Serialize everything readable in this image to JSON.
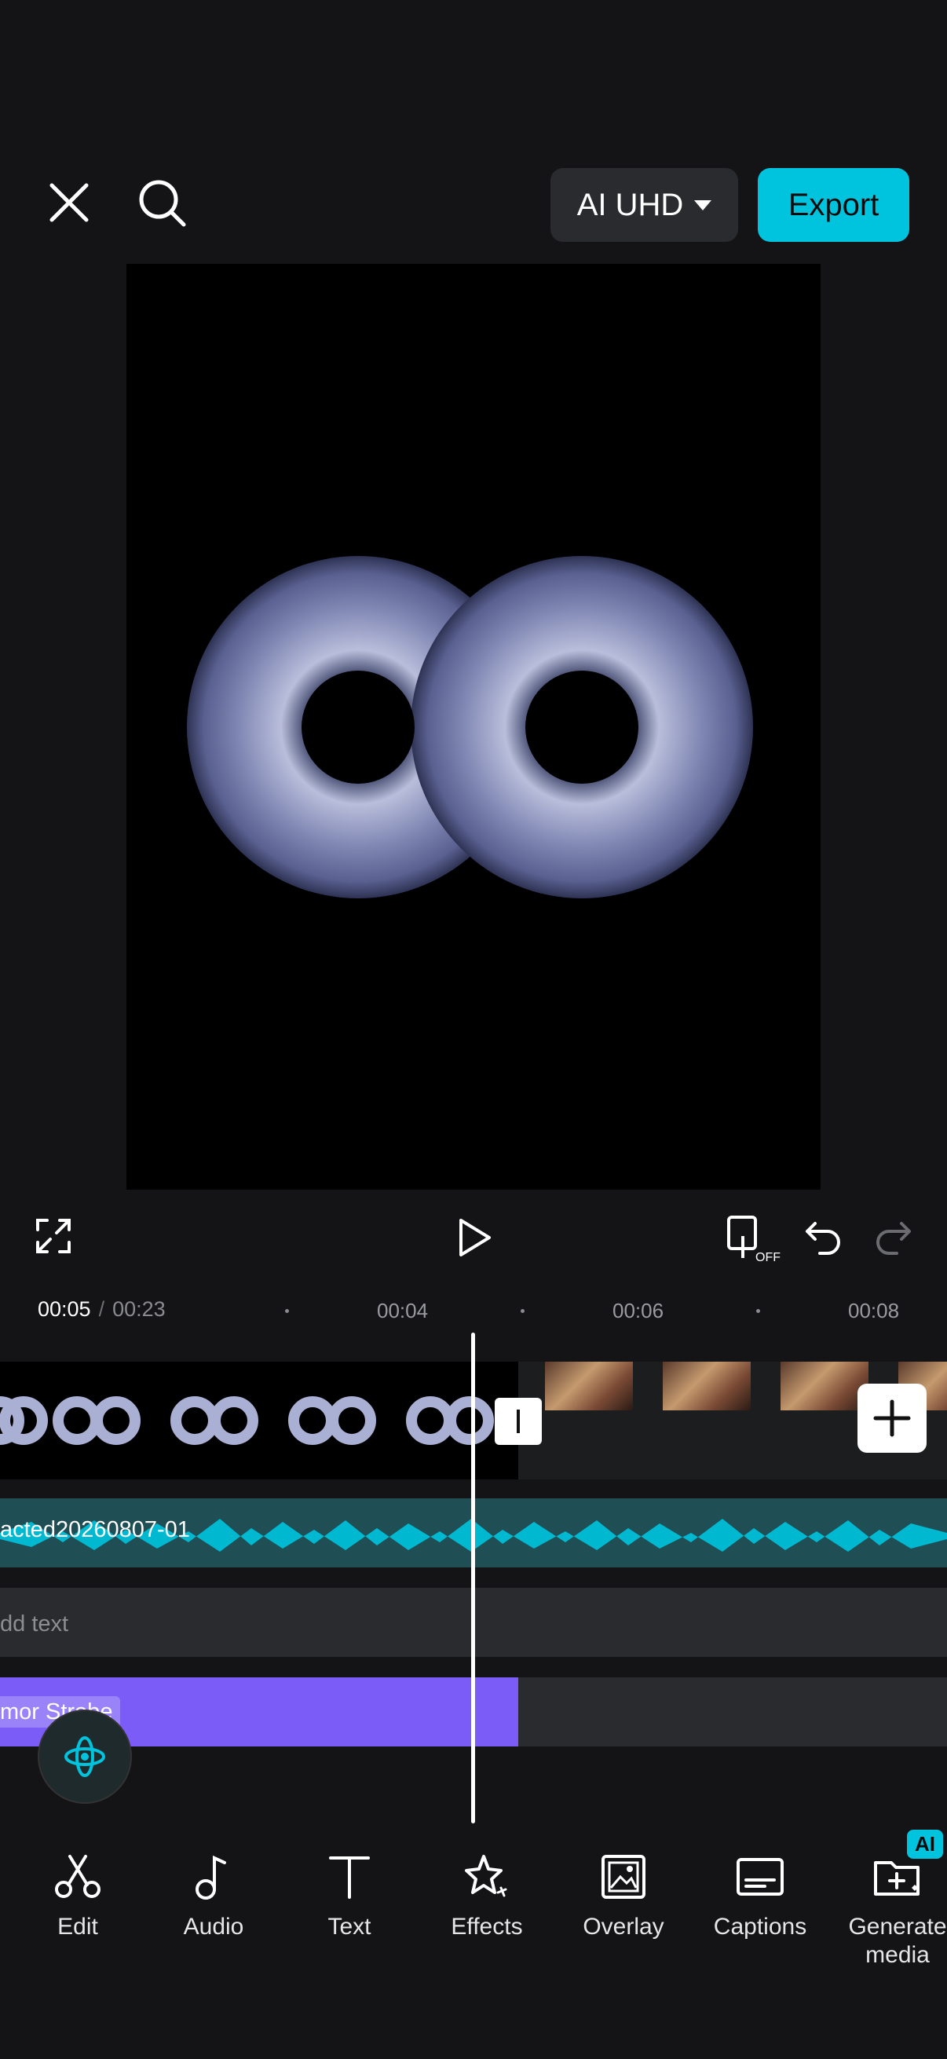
{
  "topbar": {
    "quality_label": "AI UHD",
    "export_label": "Export"
  },
  "playback": {
    "current_time": "00:05",
    "separator": "/",
    "total_time": "00:23",
    "ticks": [
      "00:04",
      "00:06",
      "00:08"
    ]
  },
  "timeline": {
    "audio_clip_label": "acted20260807-01",
    "text_track_placeholder": "dd text",
    "effect_clip_label": "mor Strobe"
  },
  "toolbar": {
    "items": [
      {
        "label": "Edit",
        "icon": "scissors-icon"
      },
      {
        "label": "Audio",
        "icon": "music-note-icon"
      },
      {
        "label": "Text",
        "icon": "text-icon"
      },
      {
        "label": "Effects",
        "icon": "star-sparkle-icon"
      },
      {
        "label": "Overlay",
        "icon": "overlay-image-icon"
      },
      {
        "label": "Captions",
        "icon": "captions-icon"
      },
      {
        "label": "Generate media",
        "icon": "generate-folder-icon"
      }
    ],
    "ai_badge": "AI"
  },
  "colors": {
    "accent": "#00c4dd",
    "effect_clip": "#7b5cf6",
    "audio_track": "#1f4e55"
  }
}
